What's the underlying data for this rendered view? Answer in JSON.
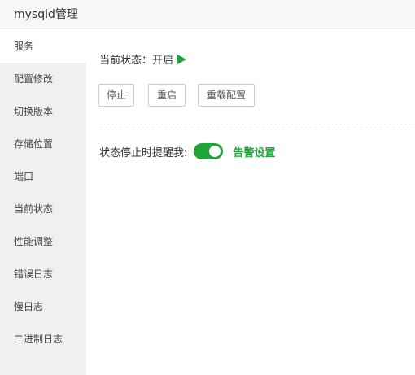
{
  "window": {
    "title": "mysqld管理"
  },
  "sidebar": {
    "items": [
      {
        "label": "服务"
      },
      {
        "label": "配置修改"
      },
      {
        "label": "切换版本"
      },
      {
        "label": "存储位置"
      },
      {
        "label": "端口"
      },
      {
        "label": "当前状态"
      },
      {
        "label": "性能调整"
      },
      {
        "label": "错误日志"
      },
      {
        "label": "慢日志"
      },
      {
        "label": "二进制日志"
      }
    ],
    "active_label": "服务"
  },
  "service": {
    "status_label": "当前状态：",
    "status_value": "开启",
    "status_icon": "play-icon",
    "buttons": {
      "stop": "停止",
      "restart": "重启",
      "reload": "重载配置"
    },
    "notify_label": "状态停止时提醒我:",
    "notify_enabled": true,
    "alarm_settings": "告警设置"
  },
  "colors": {
    "accent": "#20a53a",
    "sidebar_bg": "#f0f0f0",
    "titlebar_bg": "#f7f7f7"
  }
}
